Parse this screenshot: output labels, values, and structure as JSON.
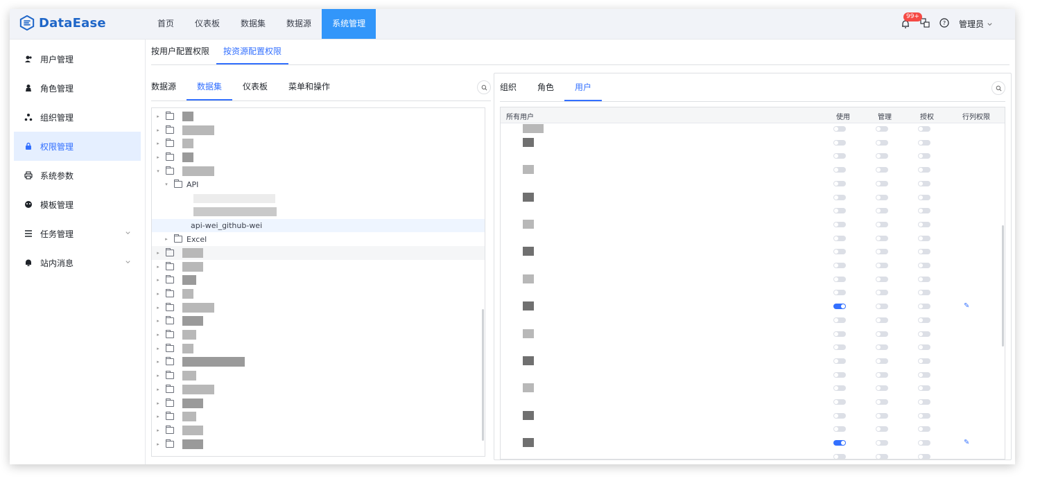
{
  "app": {
    "name": "DataEase"
  },
  "topnav": [
    {
      "label": "首页",
      "active": false
    },
    {
      "label": "仪表板",
      "active": false
    },
    {
      "label": "数据集",
      "active": false
    },
    {
      "label": "数据源",
      "active": false
    },
    {
      "label": "系统管理",
      "active": true
    }
  ],
  "header": {
    "badge": "99+",
    "user": "管理员"
  },
  "sidebar": [
    {
      "label": "用户管理",
      "icon": "user-icon",
      "active": false
    },
    {
      "label": "角色管理",
      "icon": "role-icon",
      "active": false
    },
    {
      "label": "组织管理",
      "icon": "org-icon",
      "active": false
    },
    {
      "label": "权限管理",
      "icon": "lock-icon",
      "active": true
    },
    {
      "label": "系统参数",
      "icon": "printer-icon",
      "active": false
    },
    {
      "label": "模板管理",
      "icon": "template-icon",
      "active": false
    },
    {
      "label": "任务管理",
      "icon": "task-icon",
      "active": false,
      "expandable": true
    },
    {
      "label": "站内消息",
      "icon": "bell-icon",
      "active": false,
      "expandable": true
    }
  ],
  "subtabs": [
    {
      "label": "按用户配置权限",
      "active": false
    },
    {
      "label": "按资源配置权限",
      "active": true
    }
  ],
  "left_tabs": [
    {
      "label": "数据源",
      "active": false
    },
    {
      "label": "数据集",
      "active": true
    },
    {
      "label": "仪表板",
      "active": false
    },
    {
      "label": "菜单和操作",
      "active": false
    }
  ],
  "tree": {
    "api_folder": "API",
    "selected_item": "api-wei_github-wei",
    "excel_folder": "Excel"
  },
  "right_tabs": [
    {
      "label": "组织",
      "active": false
    },
    {
      "label": "角色",
      "active": false
    },
    {
      "label": "用户",
      "active": true
    }
  ],
  "table": {
    "headers": {
      "name": "所有用户",
      "use": "使用",
      "manage": "管理",
      "grant": "授权",
      "rowcol": "行列权限"
    },
    "enabled_rows": [
      13,
      23
    ]
  },
  "colors": {
    "accent": "#3370ff",
    "nav_active": "#3296fa",
    "logo": "#1f66c8",
    "badge": "#f54a45"
  }
}
